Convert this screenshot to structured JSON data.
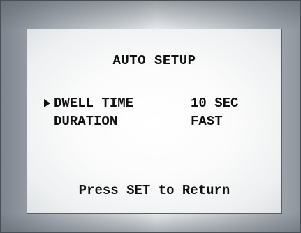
{
  "screen": {
    "title": "AUTO SETUP",
    "menu": [
      {
        "label": "DWELL TIME",
        "value": "10 SEC",
        "selected": true
      },
      {
        "label": "DURATION",
        "value": "FAST",
        "selected": false
      }
    ],
    "cursor_icon": "right-triangle-cursor",
    "footer": "Press SET to Return"
  }
}
